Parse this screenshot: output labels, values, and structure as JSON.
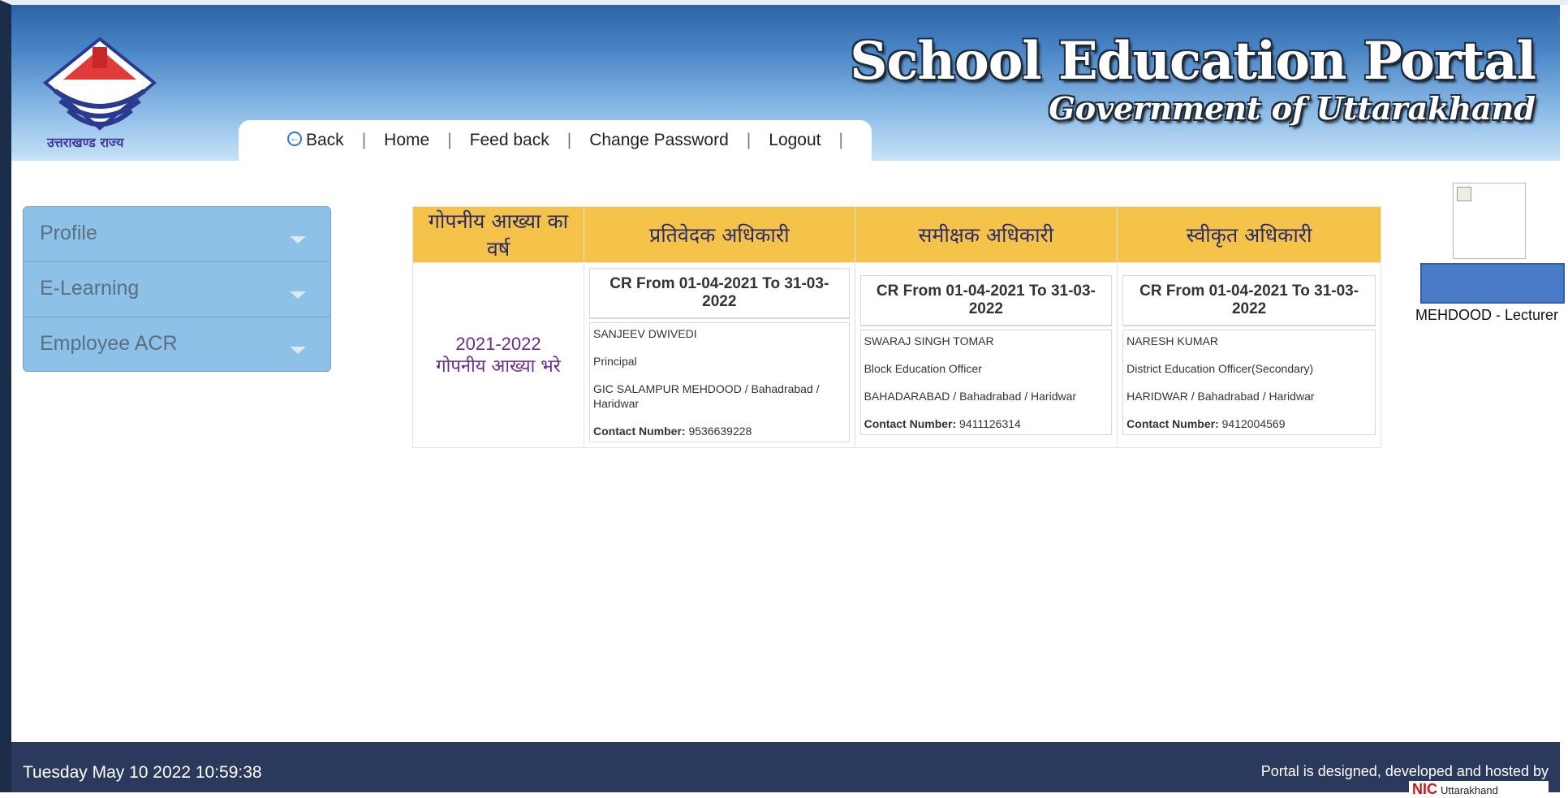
{
  "header": {
    "logo_caption": "उत्तराखण्ड राज्य",
    "title_line1": "School Education Portal",
    "title_line2": "Government of Uttarakhand"
  },
  "nav": {
    "back": "Back",
    "home": "Home",
    "feedback": "Feed back",
    "change_password": "Change Password",
    "logout": "Logout",
    "separator": "|"
  },
  "sidebar": {
    "items": [
      {
        "label": "Profile"
      },
      {
        "label": "E-Learning"
      },
      {
        "label": "Employee ACR"
      }
    ]
  },
  "table": {
    "headers": [
      "गोपनीय आख्या का वर्ष",
      "प्रतिवेदक अधिकारी",
      "समीक्षक अधिकारी",
      "स्वीकृत अधिकारी"
    ],
    "row": {
      "year": "2021-2022",
      "year_action": "गोपनीय आख्या भरे",
      "officers": [
        {
          "cr": "CR From 01-04-2021 To 31-03-2022",
          "name": "SANJEEV DWIVEDI",
          "designation": "Principal",
          "office": "GIC SALAMPUR MEHDOOD / Bahadrabad / Haridwar",
          "contact_label": "Contact Number:",
          "contact": "9536639228"
        },
        {
          "cr": "CR From 01-04-2021 To 31-03-2022",
          "name": "SWARAJ SINGH TOMAR",
          "designation": "Block Education Officer",
          "office": "BAHADARABAD / Bahadrabad / Haridwar",
          "contact_label": "Contact Number:",
          "contact": "9411126314"
        },
        {
          "cr": "CR From 01-04-2021 To 31-03-2022",
          "name": "NARESH KUMAR",
          "designation": "District Education Officer(Secondary)",
          "office": "HARIDWAR / Bahadrabad / Haridwar",
          "contact_label": "Contact Number:",
          "contact": "9412004569"
        }
      ]
    }
  },
  "profile": {
    "role": "MEHDOOD - Lecturer"
  },
  "footer": {
    "datetime": "Tuesday May 10 2022 10:59:38",
    "hosted_by": "Portal is designed, developed and hosted by",
    "nic": "NIC",
    "nic_state": "Uttarakhand"
  }
}
